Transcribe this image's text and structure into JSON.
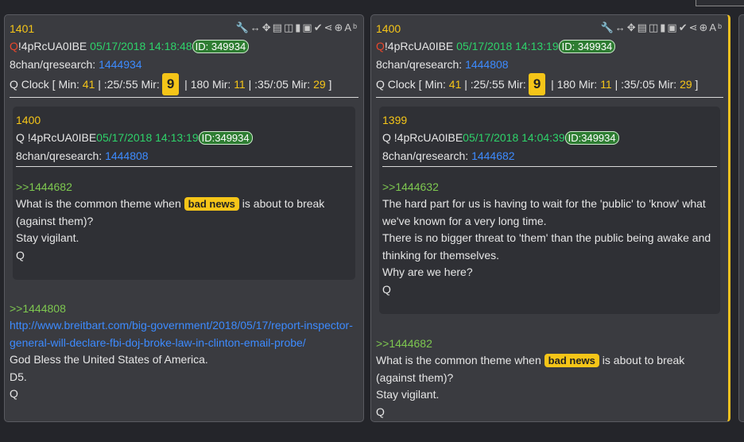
{
  "cards": [
    {
      "post_number": "1401",
      "q": "Q",
      "trip": "!4pRcUA0IBE",
      "date": "05/17/2018 14:18:48",
      "id_badge": "ID: 349934",
      "board": "8chan/qresearch:",
      "board_link": "1444934",
      "clock": {
        "prefix": "Q Clock [ Min:",
        "min": "41",
        "sep1": " | :25/:55 Mir:",
        "hour": "9",
        "sep2": " | 180 Mir:",
        "mir": "11",
        "sep3": " | :35/:05 Mir:",
        "mir2": "29",
        "suffix": " ]"
      },
      "quote": {
        "post_number": "1400",
        "q_trip": "Q !4pRcUA0IBE",
        "date": "05/17/2018 14:13:19",
        "id_badge": "ID:349934",
        "board": "8chan/qresearch:",
        "board_link": "1444808",
        "reply": ">>1444682",
        "text_before": "What is the common theme when ",
        "badge": "bad news",
        "text_after": " is about to break (against them)?",
        "lines": [
          "Stay vigilant.",
          "Q"
        ]
      },
      "reply": ">>1444808",
      "url": "http://www.breitbart.com/big-government/2018/05/17/report-inspector-general-will-declare-fbi-doj-broke-law-in-clinton-email-probe/",
      "lines": [
        "God Bless the United States of America.",
        "D5.",
        "Q"
      ]
    },
    {
      "post_number": "1400",
      "q": "Q",
      "trip": "!4pRcUA0IBE",
      "date": "05/17/2018 14:13:19",
      "id_badge": "ID: 349934",
      "board": "8chan/qresearch:",
      "board_link": "1444808",
      "clock": {
        "prefix": "Q Clock [ Min:",
        "min": "41",
        "sep1": " | :25/:55 Mir:",
        "hour": "9",
        "sep2": " | 180 Mir:",
        "mir": "11",
        "sep3": " | :35/:05 Mir:",
        "mir2": "29",
        "suffix": " ]"
      },
      "quote": {
        "post_number": "1399",
        "q_trip": "Q !4pRcUA0IBE",
        "date": "05/17/2018 14:04:39",
        "id_badge": "ID:349934",
        "board": "8chan/qresearch:",
        "board_link": "1444682",
        "reply": ">>1444632",
        "lines": [
          "The hard part for us is having to wait for the 'public' to 'know' what we've known for a very long time.",
          "There is no bigger threat to 'them' than the public being awake and thinking for themselves.",
          "Why are we here?",
          "Q"
        ]
      },
      "reply": ">>1444682",
      "text_before": "What is the common theme when ",
      "badge": "bad news",
      "text_after": " is about to break (against them)?",
      "lines": [
        "Stay vigilant.",
        "Q"
      ]
    }
  ],
  "toolbar_icons": [
    "wrench-icon",
    "resize-horizontal-icon",
    "move-icon",
    "document-icon",
    "glasses-icon",
    "trash-icon",
    "clipboard-check-icon",
    "check-icon",
    "share-icon",
    "up-circle-icon",
    "spellcheck-icon"
  ]
}
